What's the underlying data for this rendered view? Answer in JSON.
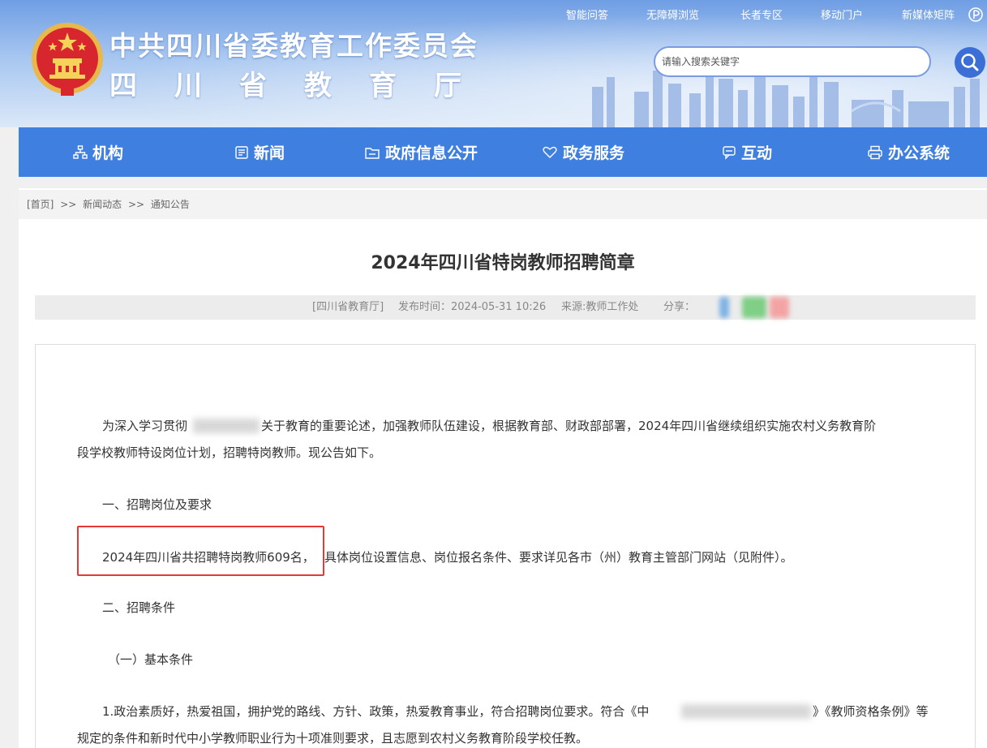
{
  "header": {
    "title": "中共四川省委教育工作委员会",
    "subtitle": "四川省教育厅",
    "top_links": [
      "智能问答",
      "无障碍浏览",
      "长者专区",
      "移动门户",
      "新媒体矩阵"
    ],
    "search": {
      "placeholder": "请输入搜索关键字"
    },
    "brand_color": "#3e7fe0"
  },
  "nav": {
    "items": [
      {
        "label": "机构",
        "icon": "org-chart-icon"
      },
      {
        "label": "新闻",
        "icon": "newspaper-icon"
      },
      {
        "label": "政府信息公开",
        "icon": "folder-info-icon"
      },
      {
        "label": "政务服务",
        "icon": "heart-hand-icon"
      },
      {
        "label": "互动",
        "icon": "chat-icon"
      },
      {
        "label": "办公系统",
        "icon": "printer-icon"
      }
    ]
  },
  "breadcrumb": {
    "home": "[首页]",
    "sep": ">>",
    "level1": "新闻动态",
    "level2": "通知公告"
  },
  "article": {
    "title": "2024年四川省特岗教师招聘简章",
    "source_org": "[四川省教育厅]",
    "publish_time": "发布时间：2024-05-31 10:26",
    "source": "来源:教师工作处",
    "share_label": "分享：",
    "paragraphs": {
      "intro_a": "为深入学习贯彻",
      "intro_b": "关于教育的重要论述，加强教师队伍建设，根据教育部、财政部部署，2024年四川省继续组织实施农村义务教育阶",
      "intro_c": "段学校教师特设岗位计划，招聘特岗教师。现公告如下。",
      "section1": "一、招聘岗位及要求",
      "quota_a": "2024年四川省共招聘特岗教师609名，",
      "quota_b": "具体岗位设置信息、岗位报名条件、要求详见各市（州）教育主管部门网站（见附件）。",
      "section2": "二、招聘条件",
      "sub1": "（一）基本条件",
      "cond1_a": "1.政治素质好，热爱祖国，拥护党的路线、方针、政策，热爱教育事业，符合招聘岗位要求。符合《中",
      "cond1_b": "》《教师资格条例》等",
      "cond1_c": "规定的条件和新时代中小学教师职业行为十项准则要求，且志愿到农村义务教育阶段学校任教。"
    }
  }
}
